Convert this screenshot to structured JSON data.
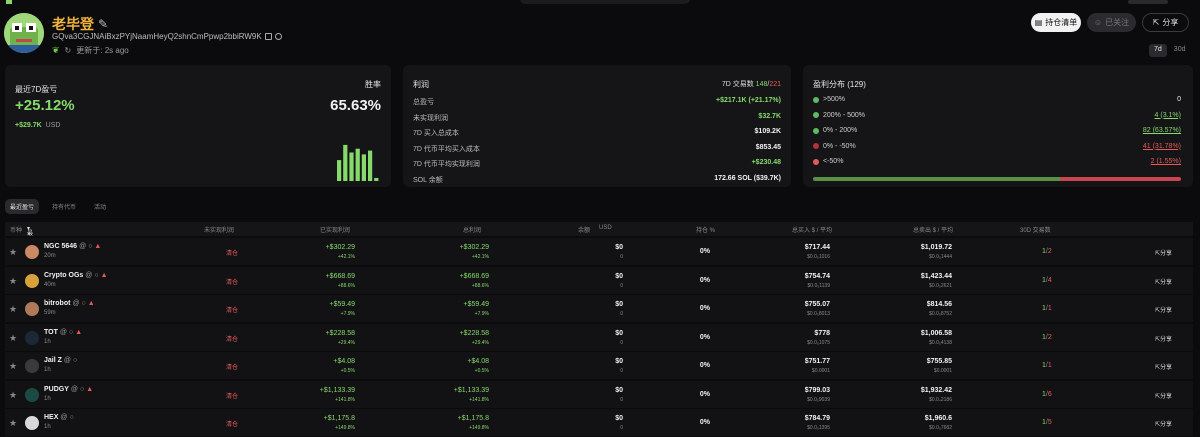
{
  "profile": {
    "name": "老毕登",
    "address": "GQva3CGJNAiBxzPYjNaamHeyQ2shnCmPpwp2bbiRW9K",
    "updated": "更新于: 2s ago"
  },
  "buttons": {
    "watchlist": "持仓清单",
    "follow": "已关注",
    "share": "分享"
  },
  "period": [
    "7d",
    "30d"
  ],
  "pnl": {
    "title": "最近7D盈亏",
    "pct": "+25.12%",
    "usd": "+$29.7K",
    "unit": "USD",
    "winrate_label": "胜率",
    "winrate": "65.63%",
    "bar_heights": [
      0.55,
      0.95,
      0.75,
      0.85,
      0.7,
      0.8,
      0.08
    ]
  },
  "profit": {
    "title": "利润",
    "tx_label": "7D 交易数",
    "tx_win": "148",
    "tx_sep": "/",
    "tx_lose": "221",
    "rows": [
      {
        "k": "总盈亏",
        "v": "+$217.1K (+21.17%)",
        "g": true
      },
      {
        "k": "未实现利润",
        "v": "$32.7K",
        "g": true
      },
      {
        "k": "7D 买入总成本",
        "v": "$109.2K",
        "g": false
      },
      {
        "k": "7D 代币平均买入成本",
        "v": "$853.45",
        "g": false
      },
      {
        "k": "7D 代币平均实现利润",
        "v": "+$230.48",
        "g": true
      },
      {
        "k": "SOL 余额",
        "v": "172.66 SOL ($39.7K)",
        "g": false
      }
    ]
  },
  "dist": {
    "title": "盈利分布 (129)",
    "rows": [
      {
        "k": ">500%",
        "v": "0",
        "color": "#5dbb63",
        "vcolor": "#f2f2f2"
      },
      {
        "k": "200% - 500%",
        "v": "4 (3.1%)",
        "color": "#5dbb63",
        "vcolor": "#86d96b"
      },
      {
        "k": "0% - 200%",
        "v": "82 (63.57%)",
        "color": "#5dbb63",
        "vcolor": "#86d96b"
      },
      {
        "k": "0% - -50%",
        "v": "41 (31.78%)",
        "color": "#b0343d",
        "vcolor": "#e45a5a"
      },
      {
        "k": "<-50%",
        "v": "2 (1.55%)",
        "color": "#e45a5a",
        "vcolor": "#e45a5a"
      }
    ],
    "bar": [
      {
        "color": "#5a8f4a",
        "w": 0.67
      },
      {
        "color": "#c9464f",
        "w": 0.33
      }
    ]
  },
  "tabs": [
    "最近盈亏",
    "持有代币",
    "活动"
  ],
  "table": {
    "headers": [
      "币种",
      "最近盈亏",
      "未实现利润",
      "已实现利润",
      "总利润",
      "余额",
      "USD",
      "持仓 %",
      "总买入 $ / 平均",
      "总卖出 $ / 平均",
      "30D 交易数"
    ],
    "rows": [
      {
        "name": "NGC 5646",
        "age": "20m",
        "av": "#c98a63",
        "clr": "清仓",
        "real": "+$302.29",
        "realp": "+42.1%",
        "tot": "+$302.29",
        "totp": "+42.1%",
        "bal": "$0",
        "bal2": "0",
        "pos": "0%",
        "buy": "$717.44",
        "buy2": "$0.0₅1016",
        "sell": "$1,019.72",
        "sell2": "$0.0₅1444",
        "w": "1",
        "l": "2",
        "warn": true
      },
      {
        "name": "Crypto OGs",
        "age": "40m",
        "av": "#d8a23a",
        "clr": "清仓",
        "real": "+$668.69",
        "realp": "+88.6%",
        "tot": "+$668.69",
        "totp": "+88.6%",
        "bal": "$0",
        "bal2": "0",
        "pos": "0%",
        "buy": "$754.74",
        "buy2": "$0.0₅1139",
        "sell": "$1,423.44",
        "sell2": "$0.0₅2621",
        "w": "1",
        "l": "4",
        "warn": true
      },
      {
        "name": "bitrobot",
        "age": "59m",
        "av": "#b07a5a",
        "clr": "清仓",
        "real": "+$59.49",
        "realp": "+7.9%",
        "tot": "+$59.49",
        "totp": "+7.9%",
        "bal": "$0",
        "bal2": "0",
        "pos": "0%",
        "buy": "$755.07",
        "buy2": "$0.0₅8013",
        "sell": "$814.56",
        "sell2": "$0.0₅8752",
        "w": "1",
        "l": "1",
        "warn": true
      },
      {
        "name": "TOT",
        "age": "1h",
        "av": "#1c2836",
        "clr": "清仓",
        "real": "+$228.58",
        "realp": "+29.4%",
        "tot": "+$228.58",
        "totp": "+29.4%",
        "bal": "$0",
        "bal2": "0",
        "pos": "0%",
        "buy": "$778",
        "buy2": "$0.0₅1075",
        "sell": "$1,006.58",
        "sell2": "$0.0₅4138",
        "w": "1",
        "l": "2",
        "warn": true
      },
      {
        "name": "Jail Z",
        "age": "1h",
        "av": "#3a3a3a",
        "clr": "清仓",
        "real": "+$4.08",
        "realp": "+0.5%",
        "tot": "+$4.08",
        "totp": "+0.5%",
        "bal": "$0",
        "bal2": "0",
        "pos": "0%",
        "buy": "$751.77",
        "buy2": "$0.0001",
        "sell": "$755.85",
        "sell2": "$0.0001",
        "w": "1",
        "l": "1",
        "warn": false
      },
      {
        "name": "PUDGY",
        "age": "1h",
        "av": "#1b4a44",
        "clr": "清仓",
        "real": "+$1,133.39",
        "realp": "+141.8%",
        "tot": "+$1,133.39",
        "totp": "+141.8%",
        "bal": "$0",
        "bal2": "0",
        "pos": "0%",
        "buy": "$799.03",
        "buy2": "$0.0₅9039",
        "sell": "$1,932.42",
        "sell2": "$0.0₄2186",
        "w": "1",
        "l": "6",
        "warn": true
      },
      {
        "name": "HEX",
        "age": "1h",
        "av": "#d9d9d9",
        "clr": "清仓",
        "real": "+$1,175.8",
        "realp": "+149.8%",
        "tot": "+$1,175.8",
        "totp": "+149.8%",
        "bal": "$0",
        "bal2": "0",
        "pos": "0%",
        "buy": "$784.79",
        "buy2": "$0.0₅1395",
        "sell": "$1,960.6",
        "sell2": "$0.0₅7682",
        "w": "1",
        "l": "5",
        "warn": false
      }
    ]
  }
}
